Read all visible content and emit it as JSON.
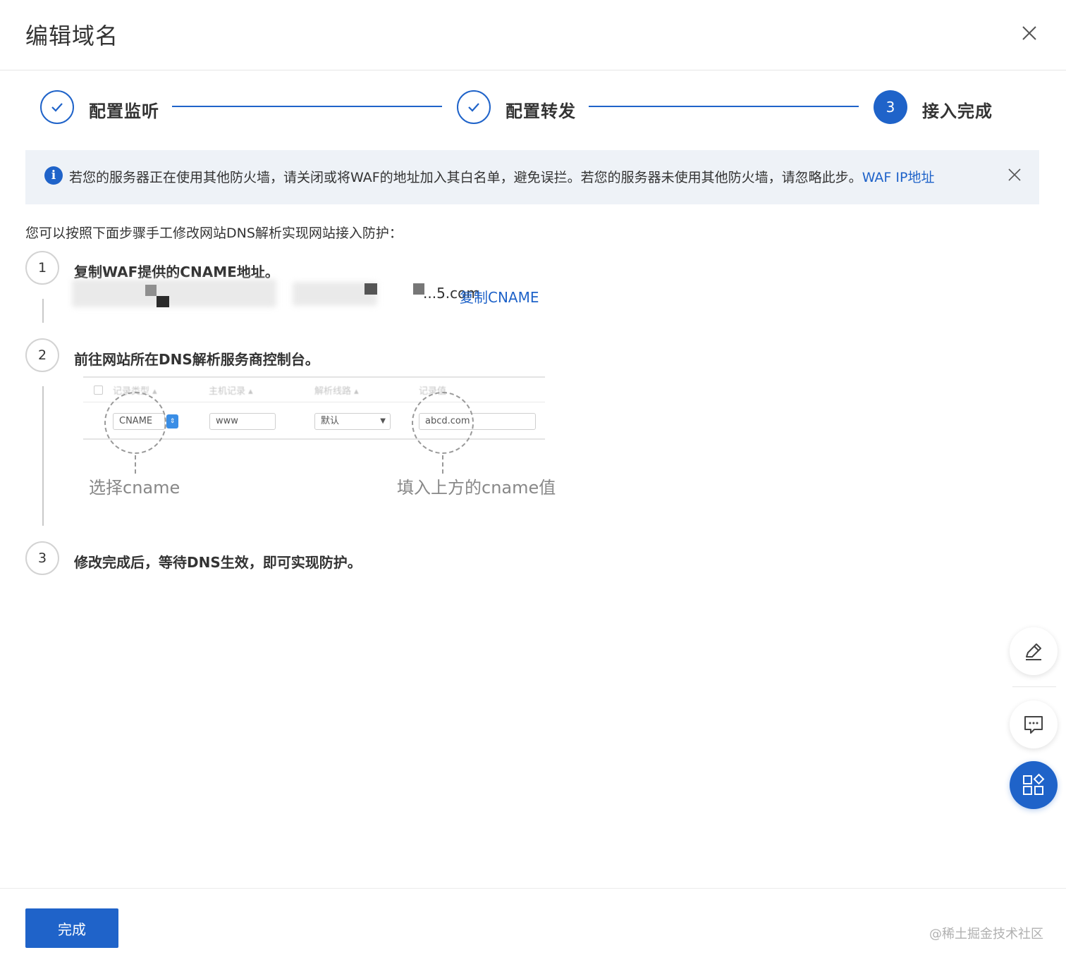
{
  "header": {
    "title": "编辑域名",
    "close_icon": "close-icon"
  },
  "steps": [
    {
      "label": "配置监听",
      "state": "done",
      "icon": "check-icon"
    },
    {
      "label": "配置转发",
      "state": "done",
      "icon": "check-icon"
    },
    {
      "number": "3",
      "label": "接入完成",
      "state": "active"
    }
  ],
  "alert": {
    "text": "若您的服务器正在使用其他防火墙，请关闭或将WAF的地址加入其白名单，避免误拦。若您的服务器未使用其他防火墙，请忽略此步。",
    "link": "WAF IP地址",
    "icon": "info-icon"
  },
  "intro": "您可以按照下面步骤手工修改网站DNS解析实现网站接入防护：",
  "instructions": [
    {
      "number": "1",
      "title": "复制WAF提供的CNAME地址。"
    },
    {
      "number": "2",
      "title": "前往网站所在DNS解析服务商控制台。"
    },
    {
      "number": "3",
      "title": "修改完成后，等待DNS生效，即可实现防护。"
    }
  ],
  "cname": {
    "value_suffix": "...5.com",
    "copy_label": "复制CNAME"
  },
  "dns_example": {
    "columns": [
      "记录类型",
      "主机记录",
      "解析线路",
      "记录值"
    ],
    "record_type": "CNAME",
    "host": "www",
    "line": "默认",
    "value": "abcd.com",
    "caption_left": "选择cname",
    "caption_right": "填入上方的cname值"
  },
  "side_tools": [
    {
      "icon": "edit-icon"
    },
    {
      "icon": "chat-icon"
    },
    {
      "icon": "apps-icon"
    }
  ],
  "footer": {
    "done_label": "完成",
    "watermark": "@稀土掘金技术社区"
  },
  "colors": {
    "primary": "#1f63c9",
    "alert_bg": "#eef2f7"
  }
}
